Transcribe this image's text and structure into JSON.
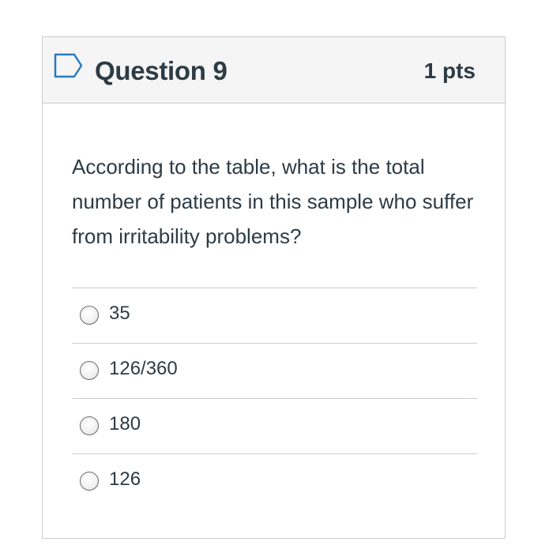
{
  "question": {
    "title": "Question 9",
    "points": "1 pts",
    "flag_icon": "flag-outline-icon",
    "text": "According to the table, what is the total number of patients in this sample who suffer from irritability problems?",
    "answers": [
      {
        "label": "35"
      },
      {
        "label": "126/360"
      },
      {
        "label": "180"
      },
      {
        "label": "126"
      }
    ]
  },
  "colors": {
    "header_background": "#f5f5f5",
    "border": "#c7cdd1",
    "text": "#2d3b45",
    "flag": "#2b7abc"
  }
}
